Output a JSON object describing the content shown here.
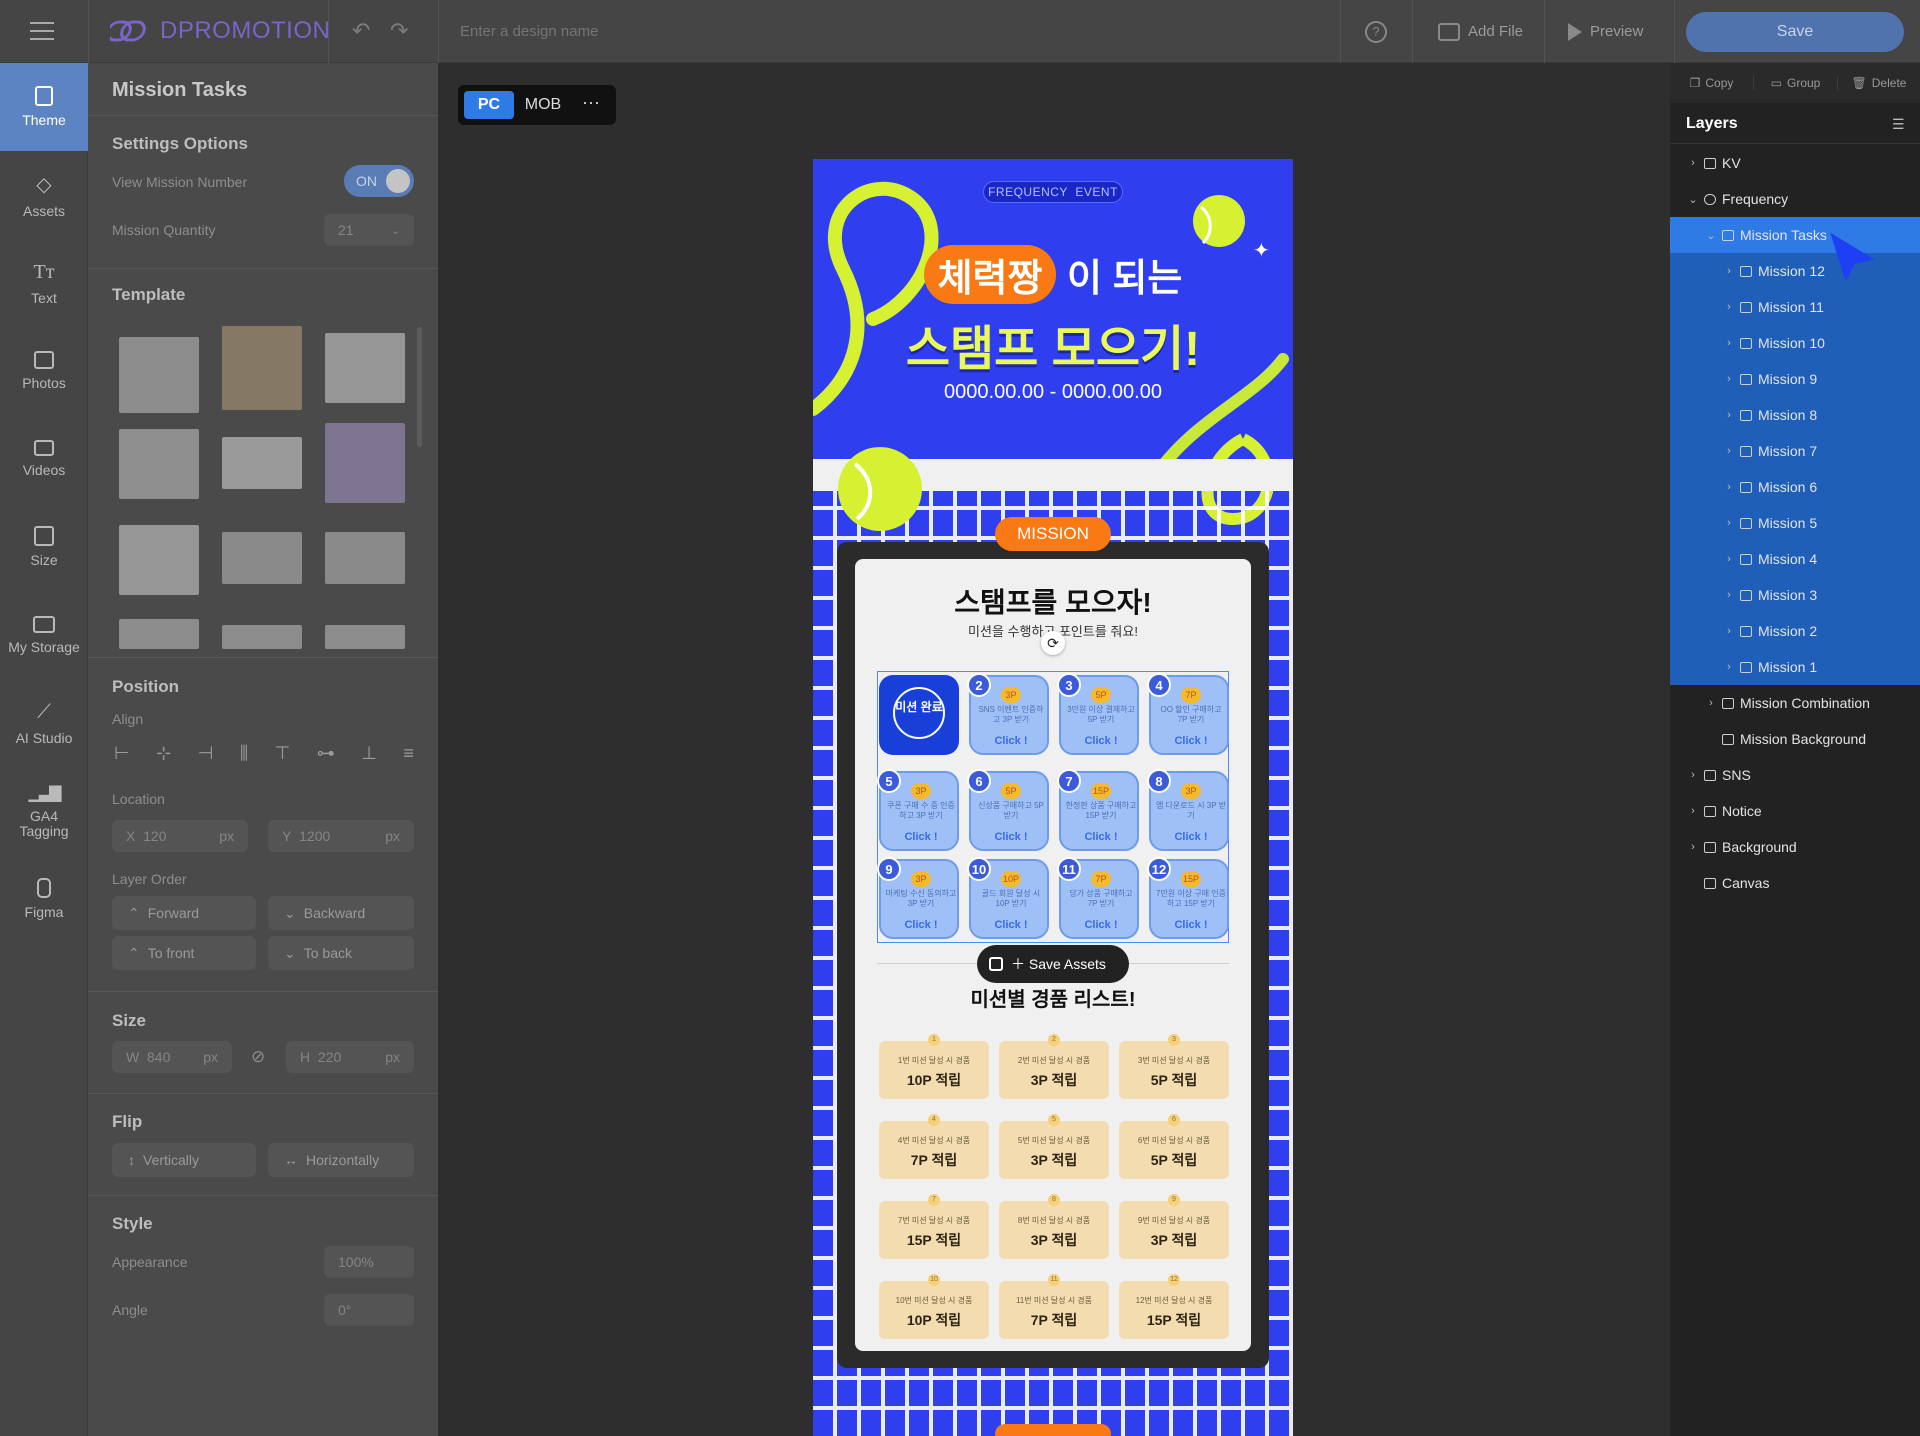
{
  "app": {
    "logo_text": "DPROMOTION",
    "design_name_placeholder": "Enter a design name",
    "add_file_label": "Add File",
    "preview_label": "Preview",
    "save_label": "Save"
  },
  "rail": [
    {
      "label": "Theme",
      "icon": "theme-icon"
    },
    {
      "label": "Assets",
      "icon": "assets-icon"
    },
    {
      "label": "Text",
      "icon": "text-icon"
    },
    {
      "label": "Photos",
      "icon": "photos-icon"
    },
    {
      "label": "Videos",
      "icon": "videos-icon"
    },
    {
      "label": "Size",
      "icon": "size-icon"
    },
    {
      "label": "My Storage",
      "icon": "folder-icon"
    },
    {
      "label": "AI Studio",
      "icon": "magic-wand-icon"
    },
    {
      "label": "GA4 Tagging",
      "icon": "analytics-icon"
    },
    {
      "label": "Figma",
      "icon": "figma-icon"
    }
  ],
  "left_panel": {
    "title": "Mission Tasks",
    "settings_title": "Settings Options",
    "view_mission_number_label": "View Mission Number",
    "view_mission_number_value": "ON",
    "mission_quantity_label": "Mission Quantity",
    "mission_quantity_value": "21",
    "template_title": "Template",
    "position_title": "Position",
    "align_label": "Align",
    "location_label": "Location",
    "x_label": "X",
    "x_value": "120",
    "y_label": "Y",
    "y_value": "1200",
    "unit_px": "px",
    "layer_order_label": "Layer Order",
    "forward_label": "Forward",
    "backward_label": "Backward",
    "to_front_label": "To front",
    "to_back_label": "To back",
    "size_title": "Size",
    "w_label": "W",
    "w_value": "840",
    "h_label": "H",
    "h_value": "220",
    "flip_title": "Flip",
    "vertically_label": "Vertically",
    "horizontally_label": "Horizontally",
    "style_title": "Style",
    "appearance_label": "Appearance",
    "appearance_value": "100%",
    "angle_label": "Angle",
    "angle_value": "0°"
  },
  "canvas": {
    "device_pc": "PC",
    "device_mob": "MOB",
    "event_badge": "FREQUENCY  EVENT",
    "headline_highlight": "체력짱",
    "headline_rest": "이 되는",
    "headline_line2": "스탬프 모으기!",
    "date_range": "0000.00.00 - 0000.00.00",
    "mission_badge": "MISSION",
    "card_title": "스탬프를 모으자!",
    "card_subtitle": "미션을 수행하고 포인트를 줘요!",
    "completed_stamp": "미션 완료",
    "click_label": "Click !",
    "save_assets_label": "Save Assets",
    "list_title": "미션별 경품 리스트!",
    "missions": [
      {
        "num": "2",
        "pt": "3P",
        "desc": "SNS 이벤트 인증하고 3P 받기"
      },
      {
        "num": "3",
        "pt": "5P",
        "desc": "3만원 이상 결제하고 5P 받기"
      },
      {
        "num": "4",
        "pt": "7P",
        "desc": "OO 할인 구매하고 7P 받기"
      },
      {
        "num": "5",
        "pt": "3P",
        "desc": "쿠폰 구매 수 증 인증하고 3P 받기"
      },
      {
        "num": "6",
        "pt": "5P",
        "desc": "신상품 구매하고 5P 받기"
      },
      {
        "num": "7",
        "pt": "15P",
        "desc": "한정판 상품 구매하고 15P 받기"
      },
      {
        "num": "8",
        "pt": "3P",
        "desc": "앱 다운로드 시 3P 받기"
      },
      {
        "num": "9",
        "pt": "3P",
        "desc": "마케팅 수신 동의하고 3P 받기"
      },
      {
        "num": "10",
        "pt": "10P",
        "desc": "골드 회원 달성 시 10P 받기"
      },
      {
        "num": "11",
        "pt": "7P",
        "desc": "당가 상품 구매하고 7P 받기"
      },
      {
        "num": "12",
        "pt": "15P",
        "desc": "7만원 이상 구매 인증하고 15P 받기"
      }
    ],
    "rewards": [
      {
        "n": "1",
        "cond": "1번 미션 달성 시 경품",
        "pts": "10P 적립"
      },
      {
        "n": "2",
        "cond": "2번 미션 달성 시 경품",
        "pts": "3P 적립"
      },
      {
        "n": "3",
        "cond": "3번 미션 달성 시 경품",
        "pts": "5P 적립"
      },
      {
        "n": "4",
        "cond": "4번 미션 달성 시 경품",
        "pts": "7P 적립"
      },
      {
        "n": "5",
        "cond": "5번 미션 달성 시 경품",
        "pts": "3P 적립"
      },
      {
        "n": "6",
        "cond": "6번 미션 달성 시 경품",
        "pts": "5P 적립"
      },
      {
        "n": "7",
        "cond": "7번 미션 달성 시 경품",
        "pts": "15P 적립"
      },
      {
        "n": "8",
        "cond": "8번 미션 달성 시 경품",
        "pts": "3P 적립"
      },
      {
        "n": "9",
        "cond": "9번 미션 달성 시 경품",
        "pts": "3P 적립"
      },
      {
        "n": "10",
        "cond": "10번 미션 달성 시 경품",
        "pts": "10P 적립"
      },
      {
        "n": "11",
        "cond": "11번 미션 달성 시 경품",
        "pts": "7P 적립"
      },
      {
        "n": "12",
        "cond": "12번 미션 달성 시 경품",
        "pts": "15P 적립"
      }
    ]
  },
  "right_panel": {
    "copy_label": "Copy",
    "group_label": "Group",
    "delete_label": "Delete",
    "layers_title": "Layers",
    "layers": [
      {
        "label": "KV",
        "depth": 0,
        "chev": "›",
        "icon": "folder-icon",
        "state": ""
      },
      {
        "label": "Frequency",
        "depth": 0,
        "chev": "⌄",
        "icon": "component-icon",
        "state": ""
      },
      {
        "label": "Mission Tasks",
        "depth": 1,
        "chev": "⌄",
        "icon": "list-icon",
        "state": "sel"
      },
      {
        "label": "Mission 12",
        "depth": 2,
        "chev": "›",
        "icon": "list-icon",
        "state": "sub"
      },
      {
        "label": "Mission 11",
        "depth": 2,
        "chev": "›",
        "icon": "list-icon",
        "state": "sub"
      },
      {
        "label": "Mission 10",
        "depth": 2,
        "chev": "›",
        "icon": "list-icon",
        "state": "sub"
      },
      {
        "label": "Mission 9",
        "depth": 2,
        "chev": "›",
        "icon": "list-icon",
        "state": "sub"
      },
      {
        "label": "Mission 8",
        "depth": 2,
        "chev": "›",
        "icon": "list-icon",
        "state": "sub"
      },
      {
        "label": "Mission 7",
        "depth": 2,
        "chev": "›",
        "icon": "list-icon",
        "state": "sub"
      },
      {
        "label": "Mission 6",
        "depth": 2,
        "chev": "›",
        "icon": "list-icon",
        "state": "sub"
      },
      {
        "label": "Mission 5",
        "depth": 2,
        "chev": "›",
        "icon": "list-icon",
        "state": "sub"
      },
      {
        "label": "Mission 4",
        "depth": 2,
        "chev": "›",
        "icon": "list-icon",
        "state": "sub"
      },
      {
        "label": "Mission 3",
        "depth": 2,
        "chev": "›",
        "icon": "list-icon",
        "state": "sub"
      },
      {
        "label": "Mission 2",
        "depth": 2,
        "chev": "›",
        "icon": "list-icon",
        "state": "sub"
      },
      {
        "label": "Mission 1",
        "depth": 2,
        "chev": "›",
        "icon": "list-icon",
        "state": "sub"
      },
      {
        "label": "Mission Combination",
        "depth": 1,
        "chev": "›",
        "icon": "stack-icon",
        "state": ""
      },
      {
        "label": "Mission Background",
        "depth": 1,
        "chev": "",
        "icon": "frame-icon",
        "state": ""
      },
      {
        "label": "SNS",
        "depth": 0,
        "chev": "›",
        "icon": "folder-icon",
        "state": ""
      },
      {
        "label": "Notice",
        "depth": 0,
        "chev": "›",
        "icon": "folder-icon",
        "state": ""
      },
      {
        "label": "Background",
        "depth": 0,
        "chev": "›",
        "icon": "folder-icon",
        "state": ""
      },
      {
        "label": "Canvas",
        "depth": -1,
        "chev": "",
        "icon": "rect-icon",
        "state": ""
      }
    ]
  },
  "colors": {
    "accent": "#2e7be6",
    "canvas_blue": "#2f3ff0",
    "lime": "#d6f032",
    "orange": "#f97a14"
  }
}
